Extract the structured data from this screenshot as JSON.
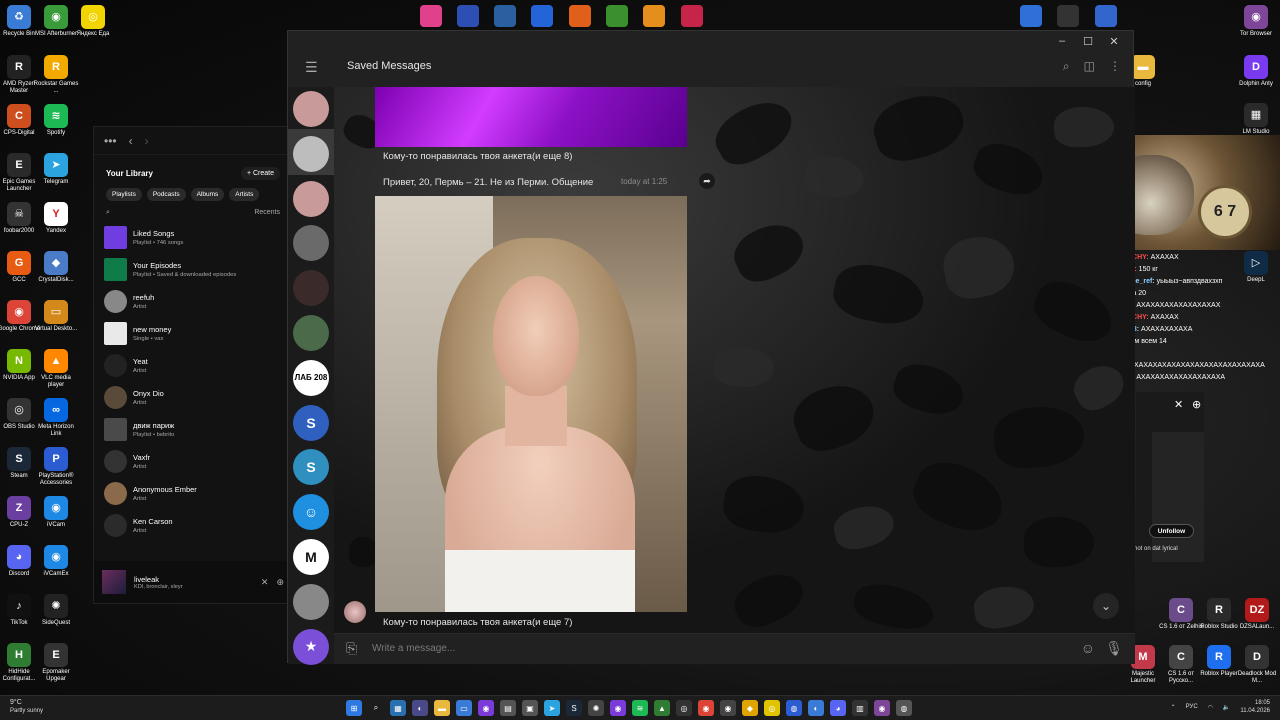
{
  "desktop": {
    "icons_left": [
      {
        "label": "Recycle Bin",
        "icon": "recycle-bin-icon",
        "color": "#3a7bd5",
        "glyph": "♻"
      },
      {
        "label": "MSI Afterburner",
        "icon": "msi-afterburner-icon",
        "color": "#3a9b3a",
        "glyph": "◉"
      },
      {
        "label": "Яндекс Еда",
        "icon": "yandex-eda-icon",
        "color": "#f2d400",
        "glyph": "◎"
      },
      {
        "label": "AMD Ryzen Master",
        "icon": "amd-ryzen-master-icon",
        "color": "#222222",
        "glyph": "R"
      },
      {
        "label": "Rockstar Games ...",
        "icon": "rockstar-games-icon",
        "color": "#f2a900",
        "glyph": "R"
      },
      {
        "label": "CPS-Digital",
        "icon": "cps-digital-icon",
        "color": "#cf4e1d",
        "glyph": "C"
      },
      {
        "label": "Spotify",
        "icon": "spotify-icon",
        "color": "#1db954",
        "glyph": "≋"
      },
      {
        "label": "Epic Games Launcher",
        "icon": "epic-games-icon",
        "color": "#2a2a2a",
        "glyph": "E"
      },
      {
        "label": "Telegram",
        "icon": "telegram-icon",
        "color": "#2aa3df",
        "glyph": "➤"
      },
      {
        "label": "foobar2000",
        "icon": "foobar2000-icon",
        "color": "#333333",
        "glyph": "☠"
      },
      {
        "label": "Yandex",
        "icon": "yandex-browser-icon",
        "color": "#ffffff",
        "glyph": "Y"
      },
      {
        "label": "GCC",
        "icon": "gcc-icon",
        "color": "#e85b13",
        "glyph": "G"
      },
      {
        "label": "CrystalDisk...",
        "icon": "crystaldisk-icon",
        "color": "#4a7cc7",
        "glyph": "◆"
      },
      {
        "label": "Google Chrome",
        "icon": "chrome-icon",
        "color": "#db4437",
        "glyph": "◉"
      },
      {
        "label": "Virtual Deskto...",
        "icon": "virtual-desktop-icon",
        "color": "#d48a1a",
        "glyph": "▭"
      },
      {
        "label": "NVIDIA App",
        "icon": "nvidia-app-icon",
        "color": "#76b900",
        "glyph": "N"
      },
      {
        "label": "VLC media player",
        "icon": "vlc-icon",
        "color": "#ff8800",
        "glyph": "▲"
      },
      {
        "label": "OBS Studio",
        "icon": "obs-studio-icon",
        "color": "#333333",
        "glyph": "◎"
      },
      {
        "label": "Meta Horizon Link",
        "icon": "meta-horizon-icon",
        "color": "#0668e1",
        "glyph": "∞"
      },
      {
        "label": "Steam",
        "icon": "steam-icon",
        "color": "#1b2838",
        "glyph": "S"
      },
      {
        "label": "PlayStation® Accessories",
        "icon": "playstation-accessories-icon",
        "color": "#2b5cd1",
        "glyph": "P"
      },
      {
        "label": "CPU-Z",
        "icon": "cpu-z-icon",
        "color": "#6b3fa0",
        "glyph": "Z"
      },
      {
        "label": "iVCam",
        "icon": "ivcam-icon",
        "color": "#1e88e5",
        "glyph": "◉"
      },
      {
        "label": "Discord",
        "icon": "discord-icon",
        "color": "#5865f2",
        "glyph": "◕"
      },
      {
        "label": "iVCamEx",
        "icon": "ivcamex-icon",
        "color": "#1e88e5",
        "glyph": "◉"
      },
      {
        "label": "TikTok",
        "icon": "tiktok-icon",
        "color": "#111111",
        "glyph": "♪"
      },
      {
        "label": "SideQuest",
        "icon": "sidequest-icon",
        "color": "#222222",
        "glyph": "✺"
      },
      {
        "label": "HidHide Configurat...",
        "icon": "hidhide-icon",
        "color": "#2f7d32",
        "glyph": "H"
      },
      {
        "label": "Epomaker Upgear",
        "icon": "epomaker-icon",
        "color": "#333333",
        "glyph": "E"
      }
    ],
    "icons_right": [
      {
        "label": "Tor Browser",
        "icon": "tor-browser-icon",
        "color": "#7d4698",
        "glyph": "◉"
      },
      {
        "label": "config",
        "icon": "config-folder-icon",
        "color": "#e8b93c",
        "glyph": "▬"
      },
      {
        "label": "Dolphin Anty",
        "icon": "dolphin-anty-icon",
        "color": "#7a3bf0",
        "glyph": "D"
      },
      {
        "label": "LM Studio",
        "icon": "lm-studio-icon",
        "color": "#2a2a2a",
        "glyph": "▦"
      },
      {
        "label": "DeepL",
        "icon": "deepl-icon",
        "color": "#0f2b46",
        "glyph": "▷"
      },
      {
        "label": "CS 1.6 от Zelhis",
        "icon": "cs16-zelhis-icon",
        "color": "#6b4b8a",
        "glyph": "C"
      },
      {
        "label": "Roblox Studio",
        "icon": "roblox-studio-icon",
        "color": "#2a2a2a",
        "glyph": "R"
      },
      {
        "label": "DZSALaun...",
        "icon": "dzsa-launcher-icon",
        "color": "#b31b1b",
        "glyph": "DZ"
      },
      {
        "label": "Majestic Launcher",
        "icon": "majestic-launcher-icon",
        "color": "#c23a4a",
        "glyph": "M"
      },
      {
        "label": "CS 1.6 от Русско...",
        "icon": "cs16-russian-icon",
        "color": "#444444",
        "glyph": "C"
      },
      {
        "label": "Roblox Player",
        "icon": "roblox-player-icon",
        "color": "#1e6ff0",
        "glyph": "R"
      },
      {
        "label": "Deadlock Mod M...",
        "icon": "deadlock-mod-icon",
        "color": "#333333",
        "glyph": "D"
      }
    ],
    "top_icons": [
      "#e0418c",
      "#2d4fb3",
      "#2a5fa0",
      "#2563d8",
      "#e0601b",
      "#3b8f2e",
      "#e48f1d",
      "#c7244a"
    ],
    "top_right_icons": [
      "#2f6fd8",
      "#333333",
      "#3366cc"
    ]
  },
  "spotify": {
    "header_title": "Your Library",
    "create_label": "Create",
    "chips": [
      "Playlists",
      "Podcasts",
      "Albums",
      "Artists"
    ],
    "sort_label": "Recents",
    "items": [
      {
        "name": "Liked Songs",
        "sub": "Playlist • 746 songs",
        "color": "#6f3de0",
        "round": false
      },
      {
        "name": "Your Episodes",
        "sub": "Playlist • Saved & downloaded episodes",
        "color": "#0f7b49",
        "round": false
      },
      {
        "name": "reefuh",
        "sub": "Artist",
        "color": "#888888",
        "round": true
      },
      {
        "name": "new money",
        "sub": "Single • vax",
        "color": "#e9e9e9",
        "round": false
      },
      {
        "name": "Yeat",
        "sub": "Artist",
        "color": "#222222",
        "round": true
      },
      {
        "name": "Onyx Dio",
        "sub": "Artist",
        "color": "#5a4a3a",
        "round": true
      },
      {
        "name": "движ париж",
        "sub": "Playlist • bebrito",
        "color": "#4a4a4a",
        "round": false
      },
      {
        "name": "Vaxfr",
        "sub": "Artist",
        "color": "#333333",
        "round": true
      },
      {
        "name": "Anonymous Ember",
        "sub": "Artist",
        "color": "#8a6a4a",
        "round": true
      },
      {
        "name": "Ken Carson",
        "sub": "Artist",
        "color": "#2b2b2b",
        "round": true
      }
    ],
    "now_playing": {
      "name": "liveleak",
      "sub": "KDI, bronclair, sleyr"
    }
  },
  "stream_chat": {
    "lines": [
      {
        "user": "WARSACHY:",
        "text": "АХАХАХ",
        "color": "#ff4b4b"
      },
      {
        "user": "slghtake:",
        "text": "150 кг",
        "color": "#ff4b4b"
      },
      {
        "user": "purulence_ref:",
        "text": "уыыыз~авпздвахзхп",
        "color": "#8fd0ff"
      },
      {
        "user": "fart:",
        "text": "вика 20",
        "color": "#8fd0ff"
      },
      {
        "user": "shizboy:",
        "text": "АХАХАХАХАХАХАХАХАХ",
        "color": "#8fd0ff"
      },
      {
        "user": "WARSACHY:",
        "text": "АХАХАХ",
        "color": "#ff4b4b"
      },
      {
        "user": "ABC1488:",
        "text": "АХАХАХАХАХА",
        "color": "#8fd0ff"
      },
      {
        "user": "fayetx:",
        "text": "им всем 14",
        "color": "#ffb14b"
      },
      {
        "user": "lsvirty:",
        "text": "ХАХАХАХАХАХАХАХАХАХАХАХАХАХАХАХАХА",
        "color": "#8fd0ff"
      },
      {
        "user": "shizboy:",
        "text": "АХАХАХАХАХАХАХАХАХА",
        "color": "#8fd0ff"
      }
    ],
    "unfollow_label": "Unfollow",
    "lyric_text": "not on dat lyrical"
  },
  "telegram": {
    "chat_title": "Saved Messages",
    "caption_top": "Кому-то понравилась твоя анкета(и еще 8)",
    "message_text": "Привет, 20, Пермь – 21. Не из Перми. Общение",
    "message_time": "today at 1:25",
    "caption_bottom": "Кому-то понравилась твоя анкета(и еще 7)",
    "input_placeholder": "Write a message...",
    "sidebar_avatars": [
      {
        "name": "avatar-chat-1",
        "color": "#c99a9a",
        "text": ""
      },
      {
        "name": "avatar-chat-2",
        "color": "#bdbdbd",
        "text": ""
      },
      {
        "name": "avatar-chat-3",
        "color": "#c99a9a",
        "text": ""
      },
      {
        "name": "avatar-chat-4",
        "color": "#6a6a6a",
        "text": ""
      },
      {
        "name": "avatar-chat-5",
        "color": "#3a2a2a",
        "text": ""
      },
      {
        "name": "avatar-chat-6",
        "color": "#4a6a4a",
        "text": ""
      },
      {
        "name": "avatar-chat-lab208",
        "color": "#ffffff",
        "text": "ЛАБ 208"
      },
      {
        "name": "avatar-chat-s1",
        "color": "#2f5fbf",
        "text": "S"
      },
      {
        "name": "avatar-chat-s2",
        "color": "#2f8fbf",
        "text": "S"
      },
      {
        "name": "avatar-chat-bot",
        "color": "#1f8fe0",
        "text": "☺"
      },
      {
        "name": "avatar-chat-m",
        "color": "#ffffff",
        "text": "M"
      },
      {
        "name": "avatar-chat-11",
        "color": "#888888",
        "text": ""
      },
      {
        "name": "avatar-chat-star",
        "color": "#7b4fd8",
        "text": "★"
      }
    ]
  },
  "taskbar": {
    "weather_temp": "9°C",
    "weather_text": "Partly sunny",
    "lang": "РУС",
    "time": "18:05",
    "date": "11.04.2026",
    "icons": [
      {
        "icon": "windows-start-icon",
        "color": "#2f7ae0",
        "glyph": "⊞"
      },
      {
        "icon": "search-icon",
        "color": "#1c1c1c",
        "glyph": "⌕"
      },
      {
        "icon": "widgets-icon",
        "color": "#2a6fb0",
        "glyph": "▦"
      },
      {
        "icon": "copilot-icon",
        "color": "#4a4a8a",
        "glyph": "◐"
      },
      {
        "icon": "file-explorer-icon",
        "color": "#e8b93c",
        "glyph": "▬"
      },
      {
        "icon": "taskbar-app-6-icon",
        "color": "#3b7bd8",
        "glyph": "▭"
      },
      {
        "icon": "taskbar-app-7-icon",
        "color": "#7b3bd8",
        "glyph": "◉"
      },
      {
        "icon": "taskbar-app-8-icon",
        "color": "#555555",
        "glyph": "▤"
      },
      {
        "icon": "taskbar-app-9-icon",
        "color": "#555555",
        "glyph": "▣"
      },
      {
        "icon": "telegram-taskbar-icon",
        "color": "#2aa3df",
        "glyph": "➤"
      },
      {
        "icon": "steam-taskbar-icon",
        "color": "#1b2838",
        "glyph": "S"
      },
      {
        "icon": "taskbar-app-12-icon",
        "color": "#444444",
        "glyph": "✺"
      },
      {
        "icon": "taskbar-app-13-icon",
        "color": "#7b3bd8",
        "glyph": "◉"
      },
      {
        "icon": "spotify-taskbar-icon",
        "color": "#1db954",
        "glyph": "≋"
      },
      {
        "icon": "taskbar-app-15-icon",
        "color": "#2f7d32",
        "glyph": "▲"
      },
      {
        "icon": "taskbar-app-16-icon",
        "color": "#333333",
        "glyph": "◎"
      },
      {
        "icon": "chrome-taskbar-icon",
        "color": "#db4437",
        "glyph": "◉"
      },
      {
        "icon": "taskbar-app-18-icon",
        "color": "#444444",
        "glyph": "◉"
      },
      {
        "icon": "taskbar-app-19-icon",
        "color": "#e0a400",
        "glyph": "◆"
      },
      {
        "icon": "taskbar-app-20-icon",
        "color": "#e0c400",
        "glyph": "◎"
      },
      {
        "icon": "taskbar-app-21-icon",
        "color": "#2b5cd1",
        "glyph": "◍"
      },
      {
        "icon": "taskbar-app-22-icon",
        "color": "#3b7bd8",
        "glyph": "◐"
      },
      {
        "icon": "discord-taskbar-icon",
        "color": "#5865f2",
        "glyph": "◕"
      },
      {
        "icon": "taskbar-app-24-icon",
        "color": "#333333",
        "glyph": "▥"
      },
      {
        "icon": "tor-taskbar-icon",
        "color": "#7d4698",
        "glyph": "◉"
      },
      {
        "icon": "taskbar-app-26-icon",
        "color": "#555555",
        "glyph": "◍"
      }
    ]
  }
}
